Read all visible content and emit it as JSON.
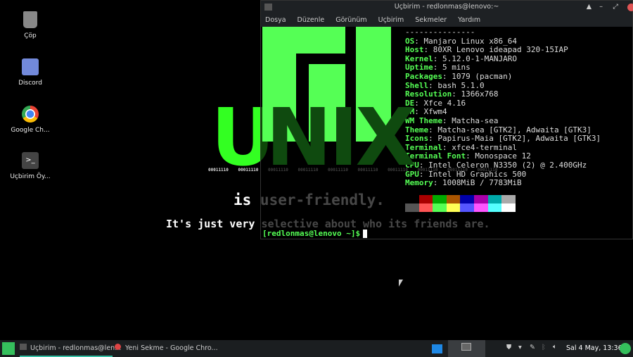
{
  "desktop": {
    "icons": [
      {
        "label": "Çöp",
        "icon": "trash-icon"
      },
      {
        "label": "Discord",
        "icon": "discord-icon"
      },
      {
        "label": "Google Ch...",
        "icon": "chrome-icon"
      },
      {
        "label": "Uçbirim Öy...",
        "icon": "terminal-icon"
      }
    ]
  },
  "wallpaper": {
    "u": "U",
    "nix": "NIX",
    "bits": "00011110 00011110 00011110 00011110 00011110 00011110 00011110 00011110 00011110 00011110",
    "line1": "is user-friendly.",
    "line2": "It's just very selective about who its friends are."
  },
  "terminal": {
    "title": "Uçbirim - redlonmas@lenovo:~",
    "menu": [
      "Dosya",
      "Düzenle",
      "Görünüm",
      "Uçbirim",
      "Sekmeler",
      "Yardım"
    ],
    "separator": "---------------",
    "info": [
      [
        "OS",
        "Manjaro Linux x86_64"
      ],
      [
        "Host",
        "80XR Lenovo ideapad 320-15IAP"
      ],
      [
        "Kernel",
        "5.12.0-1-MANJARO"
      ],
      [
        "Uptime",
        "5 mins"
      ],
      [
        "Packages",
        "1079 (pacman)"
      ],
      [
        "Shell",
        "bash 5.1.0"
      ],
      [
        "Resolution",
        "1366x768"
      ],
      [
        "DE",
        "Xfce 4.16"
      ],
      [
        "WM",
        "Xfwm4"
      ],
      [
        "WM Theme",
        "Matcha-sea"
      ],
      [
        "Theme",
        "Matcha-sea [GTK2], Adwaita [GTK3]"
      ],
      [
        "Icons",
        "Papirus-Maia [GTK2], Adwaita [GTK3]"
      ],
      [
        "Terminal",
        "xfce4-terminal"
      ],
      [
        "Terminal Font",
        "Monospace 12"
      ],
      [
        "CPU",
        "Intel Celeron N3350 (2) @ 2.400GHz"
      ],
      [
        "GPU",
        "Intel HD Graphics 500"
      ],
      [
        "Memory",
        "1008MiB / 7783MiB"
      ]
    ],
    "palette": [
      "#000000",
      "#aa0000",
      "#00aa00",
      "#aa5500",
      "#0000aa",
      "#aa00aa",
      "#00aaaa",
      "#aaaaaa",
      "#555555",
      "#ff5555",
      "#55ff55",
      "#ffff55",
      "#5555ff",
      "#ff55ff",
      "#55ffff",
      "#ffffff"
    ],
    "prompt": "[redlonmas@lenovo ~]$"
  },
  "taskbar": {
    "tasks": [
      "Uçbirim - redlonmas@len...",
      "Yeni Sekme - Google Chro..."
    ],
    "clock": "Sal 4 May, 13:36"
  }
}
